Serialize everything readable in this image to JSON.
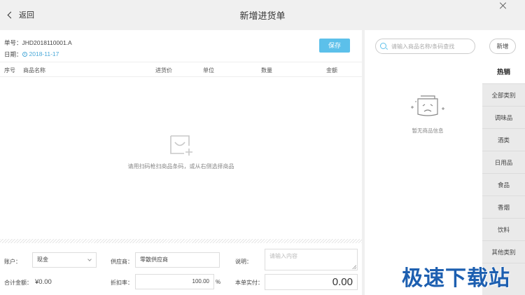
{
  "header": {
    "back_label": "返回",
    "title": "新增进货单"
  },
  "order": {
    "number_label": "单号：",
    "number_value": "JHD2018110001.A",
    "date_label": "日期：",
    "date_value": "2018-11-17",
    "save_label": "保存"
  },
  "table": {
    "columns": [
      "序号",
      "商品名称",
      "进货价",
      "单位",
      "数量",
      "金额"
    ]
  },
  "empty_state": {
    "message": "请用扫码枪扫商品条码，或从右侧选择商品",
    "icon": "cart-plus-icon"
  },
  "form": {
    "account_label": "账户：",
    "account_value": "现金",
    "supplier_label": "供应商：",
    "supplier_value": "零散供应商",
    "note_label": "说明：",
    "note_placeholder": "请输入内容",
    "total_label": "合计金额：",
    "total_value": "¥0.00",
    "discount_label": "折扣率：",
    "discount_value": "100.00",
    "discount_unit": "%",
    "paid_label": "本单实付：",
    "paid_value": "0.00"
  },
  "sidebar": {
    "search_placeholder": "请输入商品名称/条码查找",
    "add_label": "新增",
    "empty_message": "暂无商品信息",
    "categories": [
      {
        "label": "热销",
        "active": true
      },
      {
        "label": "全部类别"
      },
      {
        "label": "调味品"
      },
      {
        "label": "酒类"
      },
      {
        "label": "日用品"
      },
      {
        "label": "食品"
      },
      {
        "label": "香烟"
      },
      {
        "label": "饮料"
      },
      {
        "label": "其他类别"
      }
    ]
  },
  "watermark": "极速下载站",
  "colors": {
    "accent": "#5cc0ea",
    "date": "#4aa8d8",
    "watermark": "#1d5fb0"
  }
}
